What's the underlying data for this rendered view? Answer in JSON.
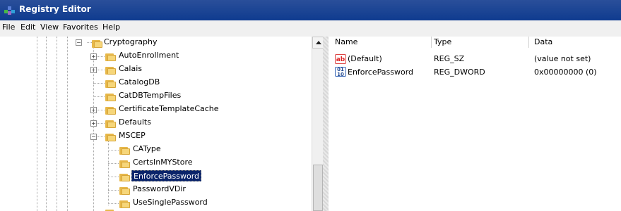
{
  "app": {
    "title": "Registry Editor",
    "icon": "registry-icon"
  },
  "menu": [
    {
      "label": "File"
    },
    {
      "label": "Edit"
    },
    {
      "label": "View"
    },
    {
      "label": "Favorites"
    },
    {
      "label": "Help"
    }
  ],
  "tree": {
    "items": [
      {
        "label": "Cryptography",
        "expanded": true,
        "icon": "folder-icon"
      },
      {
        "label": "AutoEnrollment",
        "expanded": false,
        "icon": "folder-icon"
      },
      {
        "label": "Calais",
        "expanded": false,
        "icon": "folder-icon"
      },
      {
        "label": "CatalogDB",
        "icon": "folder-icon"
      },
      {
        "label": "CatDBTempFiles",
        "icon": "folder-icon"
      },
      {
        "label": "CertificateTemplateCache",
        "expanded": false,
        "icon": "folder-icon"
      },
      {
        "label": "Defaults",
        "expanded": false,
        "icon": "folder-icon"
      },
      {
        "label": "MSCEP",
        "expanded": true,
        "icon": "folder-icon"
      },
      {
        "label": "CAType",
        "icon": "folder-icon"
      },
      {
        "label": "CertsInMYStore",
        "icon": "folder-icon"
      },
      {
        "label": "EnforcePassword",
        "selected": true,
        "icon": "folder-icon"
      },
      {
        "label": "PasswordVDir",
        "icon": "folder-icon"
      },
      {
        "label": "UseSinglePassword",
        "icon": "folder-icon"
      }
    ]
  },
  "values": {
    "columns": [
      "Name",
      "Type",
      "Data"
    ],
    "rows": [
      {
        "name": "(Default)",
        "type": "REG_SZ",
        "data": "(value not set)",
        "icon": "string-value-icon"
      },
      {
        "name": "EnforcePassword",
        "type": "REG_DWORD",
        "data": "0x00000000 (0)",
        "icon": "dword-value-icon"
      }
    ]
  },
  "colors": {
    "titlebar": "#0f3b8f",
    "selected": "#0a246a",
    "folder": "#f6d67a"
  }
}
